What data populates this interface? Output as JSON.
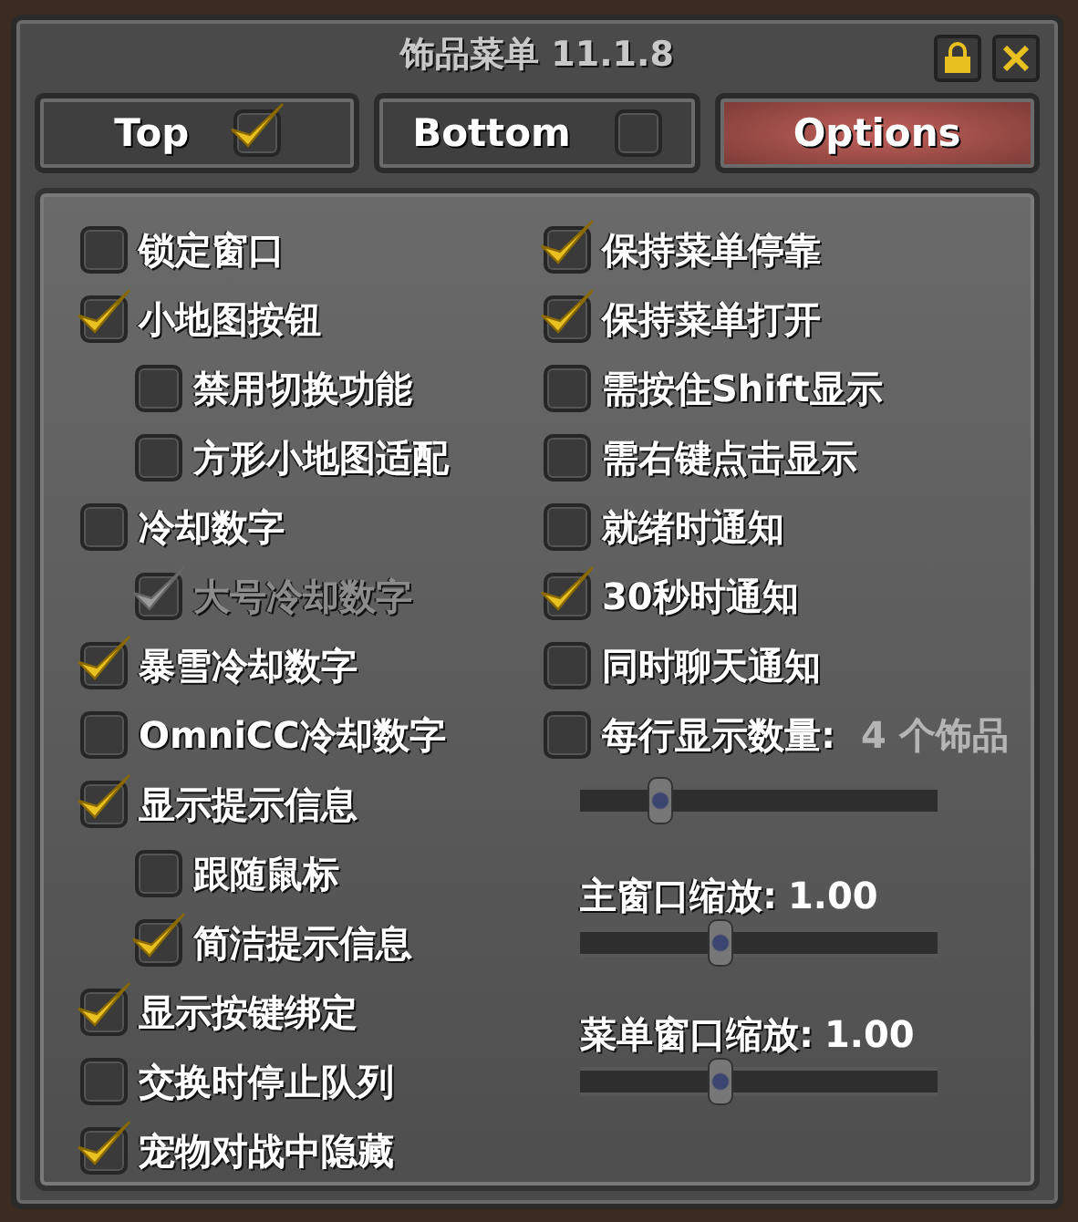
{
  "window": {
    "title": "饰品菜单 11.1.8"
  },
  "tabs": [
    {
      "label": "Top",
      "selected": false,
      "checked": true
    },
    {
      "label": "Bottom",
      "selected": false,
      "checked": false
    },
    {
      "label": "Options",
      "selected": true
    }
  ],
  "left_options": [
    {
      "label": "锁定窗口",
      "checked": false,
      "disabled": false
    },
    {
      "label": "小地图按钮",
      "checked": true,
      "disabled": false,
      "children": [
        {
          "label": "禁用切换功能",
          "checked": false,
          "disabled": false
        },
        {
          "label": "方形小地图适配",
          "checked": false,
          "disabled": false
        }
      ]
    },
    {
      "label": "冷却数字",
      "checked": false,
      "disabled": false,
      "children": [
        {
          "label": "大号冷却数字",
          "checked": true,
          "disabled": true
        }
      ]
    },
    {
      "label": "暴雪冷却数字",
      "checked": true,
      "disabled": false
    },
    {
      "label": "OmniCC冷却数字",
      "checked": false,
      "disabled": false
    },
    {
      "label": "显示提示信息",
      "checked": true,
      "disabled": false,
      "children": [
        {
          "label": "跟随鼠标",
          "checked": false,
          "disabled": false
        },
        {
          "label": "简洁提示信息",
          "checked": true,
          "disabled": false
        }
      ]
    },
    {
      "label": "显示按键绑定",
      "checked": true,
      "disabled": false
    },
    {
      "label": "交换时停止队列",
      "checked": false,
      "disabled": false
    },
    {
      "label": "宠物对战中隐藏",
      "checked": true,
      "disabled": false
    }
  ],
  "right_options": [
    {
      "kind": "checkbox",
      "label": "保持菜单停靠",
      "checked": true
    },
    {
      "kind": "checkbox",
      "label": "保持菜单打开",
      "checked": true
    },
    {
      "kind": "checkbox",
      "label": "需按住Shift显示",
      "checked": false
    },
    {
      "kind": "checkbox",
      "label": "需右键点击显示",
      "checked": false
    },
    {
      "kind": "checkbox",
      "label": "就绪时通知",
      "checked": false
    },
    {
      "kind": "checkbox",
      "label": "30秒时通知",
      "checked": true
    },
    {
      "kind": "checkbox",
      "label": "同时聊天通知",
      "checked": false
    },
    {
      "kind": "checkbox",
      "label": "每行显示数量:",
      "value": "4 个饰品",
      "checked": false
    },
    {
      "kind": "slider",
      "level": 0.22
    },
    {
      "kind": "slider",
      "label": "主窗口缩放:",
      "value": "1.00",
      "level": 0.39
    },
    {
      "kind": "slider",
      "label": "菜单窗口缩放:",
      "value": "1.00",
      "level": 0.39
    }
  ]
}
